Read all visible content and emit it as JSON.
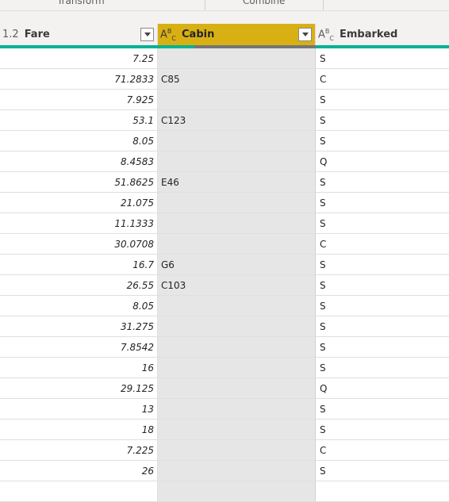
{
  "ribbon": {
    "groups": [
      "Transform",
      "Combine"
    ]
  },
  "columns": [
    {
      "type_label": "1.2",
      "name": "Fare",
      "selected": false
    },
    {
      "type_label": "ABC",
      "name": "Cabin",
      "selected": true
    },
    {
      "type_label": "ABC",
      "name": "Embarked",
      "selected": false
    }
  ],
  "colors": {
    "selected_header": "#d9b014",
    "quality_valid": "#00b294",
    "quality_empty": "#757575",
    "selected_column_bg": "#e6e6e6"
  },
  "rows": [
    {
      "fare": "7.25",
      "cabin": "",
      "embarked": "S"
    },
    {
      "fare": "71.2833",
      "cabin": "C85",
      "embarked": "C"
    },
    {
      "fare": "7.925",
      "cabin": "",
      "embarked": "S"
    },
    {
      "fare": "53.1",
      "cabin": "C123",
      "embarked": "S"
    },
    {
      "fare": "8.05",
      "cabin": "",
      "embarked": "S"
    },
    {
      "fare": "8.4583",
      "cabin": "",
      "embarked": "Q"
    },
    {
      "fare": "51.8625",
      "cabin": "E46",
      "embarked": "S"
    },
    {
      "fare": "21.075",
      "cabin": "",
      "embarked": "S"
    },
    {
      "fare": "11.1333",
      "cabin": "",
      "embarked": "S"
    },
    {
      "fare": "30.0708",
      "cabin": "",
      "embarked": "C"
    },
    {
      "fare": "16.7",
      "cabin": "G6",
      "embarked": "S"
    },
    {
      "fare": "26.55",
      "cabin": "C103",
      "embarked": "S"
    },
    {
      "fare": "8.05",
      "cabin": "",
      "embarked": "S"
    },
    {
      "fare": "31.275",
      "cabin": "",
      "embarked": "S"
    },
    {
      "fare": "7.8542",
      "cabin": "",
      "embarked": "S"
    },
    {
      "fare": "16",
      "cabin": "",
      "embarked": "S"
    },
    {
      "fare": "29.125",
      "cabin": "",
      "embarked": "Q"
    },
    {
      "fare": "13",
      "cabin": "",
      "embarked": "S"
    },
    {
      "fare": "18",
      "cabin": "",
      "embarked": "S"
    },
    {
      "fare": "7.225",
      "cabin": "",
      "embarked": "C"
    },
    {
      "fare": "26",
      "cabin": "",
      "embarked": "S"
    },
    {
      "fare": "",
      "cabin": "",
      "embarked": ""
    }
  ]
}
